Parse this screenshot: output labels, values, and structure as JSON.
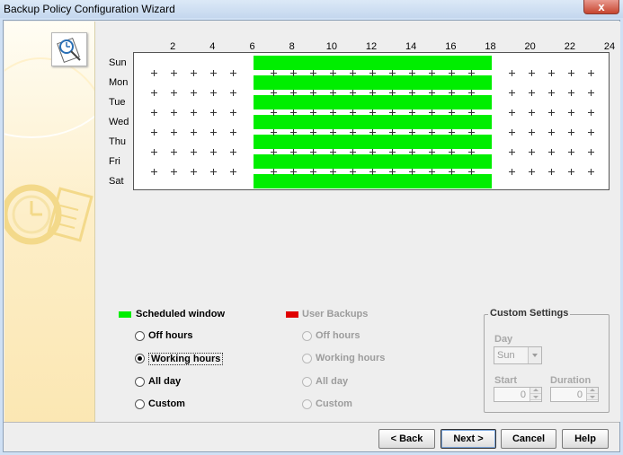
{
  "window": {
    "title": "Backup Policy Configuration Wizard",
    "close_label": "x"
  },
  "schedule": {
    "hours": [
      "2",
      "4",
      "6",
      "8",
      "10",
      "12",
      "14",
      "16",
      "18",
      "20",
      "22",
      "24"
    ],
    "days": [
      "Sun",
      "Mon",
      "Tue",
      "Wed",
      "Thu",
      "Fri",
      "Sat"
    ],
    "window_start_hour": 6,
    "window_end_hour": 18,
    "window_color": "#00ee00"
  },
  "scheduled": {
    "legend": "Scheduled window",
    "color": "#00ee00",
    "options": [
      {
        "label": "Off hours",
        "selected": false
      },
      {
        "label": "Working hours",
        "selected": true
      },
      {
        "label": "All day",
        "selected": false
      },
      {
        "label": "Custom",
        "selected": false
      }
    ]
  },
  "user_backups": {
    "legend": "User Backups",
    "color": "#e00000",
    "options": [
      {
        "label": "Off hours"
      },
      {
        "label": "Working hours"
      },
      {
        "label": "All day"
      },
      {
        "label": "Custom"
      }
    ]
  },
  "custom": {
    "title": "Custom Settings",
    "day_label": "Day",
    "day_value": "Sun",
    "start_label": "Start",
    "start_value": "0",
    "duration_label": "Duration",
    "duration_value": "0"
  },
  "buttons": {
    "back": "< Back",
    "next": "Next >",
    "cancel": "Cancel",
    "help": "Help"
  }
}
